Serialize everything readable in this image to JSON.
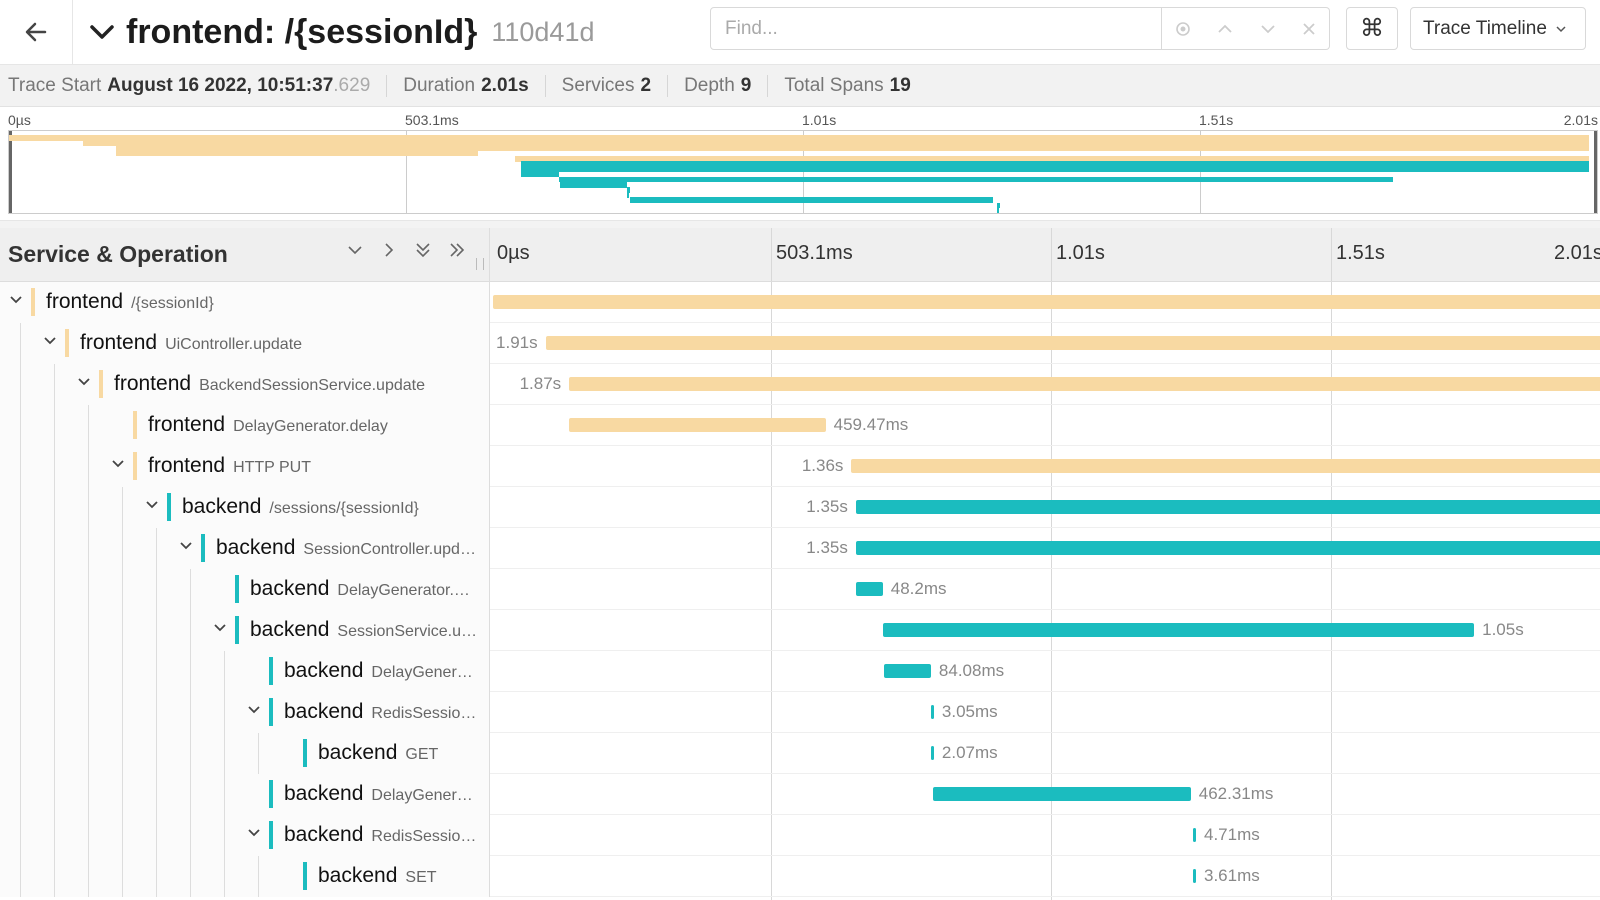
{
  "header": {
    "title": "frontend: /{sessionId}",
    "trace_id": "110d41d",
    "find_placeholder": "Find...",
    "command_symbol": "⌘",
    "view_label": "Trace Timeline"
  },
  "meta": {
    "trace_start_label": "Trace Start",
    "trace_start_value": "August 16 2022, 10:51:37",
    "trace_start_ms": ".629",
    "duration_label": "Duration",
    "duration_value": "2.01s",
    "services_label": "Services",
    "services_value": "2",
    "depth_label": "Depth",
    "depth_value": "9",
    "total_spans_label": "Total Spans",
    "total_spans_value": "19"
  },
  "ticks": [
    "0µs",
    "503.1ms",
    "1.01s",
    "1.51s",
    "2.01s"
  ],
  "columns": {
    "service_operation": "Service & Operation"
  },
  "colors": {
    "frontend": "#f8d9a2",
    "backend": "#1bbcbf",
    "frontend_marker": "#f8d9a2",
    "backend_marker": "#1bbcbf"
  },
  "spans": [
    {
      "service": "frontend",
      "operation": "/{sessionId}",
      "depth": 0,
      "expandable": true,
      "start": 0,
      "end": 1.0,
      "label": ""
    },
    {
      "service": "frontend",
      "operation": "UiController.update",
      "depth": 1,
      "expandable": true,
      "start": 0.047,
      "end": 1.0,
      "label": "1.91s"
    },
    {
      "service": "frontend",
      "operation": "BackendSessionService.update",
      "depth": 2,
      "expandable": true,
      "start": 0.068,
      "end": 1.0,
      "label": "1.87s"
    },
    {
      "service": "frontend",
      "operation": "DelayGenerator.delay",
      "depth": 3,
      "expandable": false,
      "start": 0.068,
      "end": 0.297,
      "label": "459.47ms"
    },
    {
      "service": "frontend",
      "operation": "HTTP PUT",
      "depth": 3,
      "expandable": true,
      "start": 0.32,
      "end": 1.0,
      "label": "1.36s"
    },
    {
      "service": "backend",
      "operation": "/sessions/{sessionId}",
      "depth": 4,
      "expandable": true,
      "start": 0.324,
      "end": 1.0,
      "label": "1.35s"
    },
    {
      "service": "backend",
      "operation": "SessionController.upd…",
      "depth": 5,
      "expandable": true,
      "start": 0.324,
      "end": 1.0,
      "label": "1.35s"
    },
    {
      "service": "backend",
      "operation": "DelayGenerator.…",
      "depth": 6,
      "expandable": false,
      "start": 0.324,
      "end": 0.348,
      "label": "48.2ms"
    },
    {
      "service": "backend",
      "operation": "SessionService.u…",
      "depth": 6,
      "expandable": true,
      "start": 0.348,
      "end": 0.876,
      "label": "1.05s"
    },
    {
      "service": "backend",
      "operation": "DelayGener…",
      "depth": 7,
      "expandable": false,
      "start": 0.349,
      "end": 0.391,
      "label": "84.08ms"
    },
    {
      "service": "backend",
      "operation": "RedisSessio…",
      "depth": 7,
      "expandable": true,
      "start": 0.391,
      "end": 0.393,
      "label": "3.05ms"
    },
    {
      "service": "backend",
      "operation": "GET",
      "depth": 8,
      "expandable": false,
      "start": 0.391,
      "end": 0.392,
      "label": "2.07ms"
    },
    {
      "service": "backend",
      "operation": "DelayGener…",
      "depth": 7,
      "expandable": false,
      "start": 0.393,
      "end": 0.623,
      "label": "462.31ms"
    },
    {
      "service": "backend",
      "operation": "RedisSessio…",
      "depth": 7,
      "expandable": true,
      "start": 0.625,
      "end": 0.627,
      "label": "4.71ms"
    },
    {
      "service": "backend",
      "operation": "SET",
      "depth": 8,
      "expandable": false,
      "start": 0.625,
      "end": 0.626,
      "label": "3.61ms"
    }
  ]
}
